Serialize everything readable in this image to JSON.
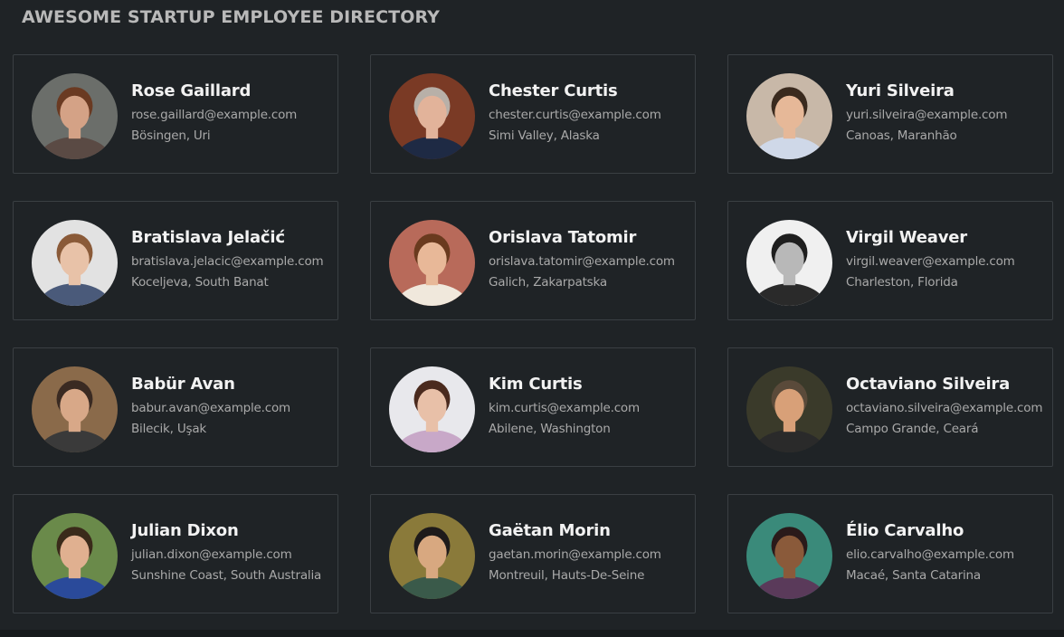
{
  "header": {
    "title": "AWESOME STARTUP EMPLOYEE DIRECTORY"
  },
  "employees": [
    {
      "name": "Rose Gaillard",
      "email": "rose.gaillard@example.com",
      "location": "Bösingen, Uri",
      "avatar": {
        "bg": "#6b6e6a",
        "skin": "#d4a286",
        "hair": "#6a3a22",
        "shirt": "#5a4a44"
      }
    },
    {
      "name": "Chester Curtis",
      "email": "chester.curtis@example.com",
      "location": "Simi Valley, Alaska",
      "avatar": {
        "bg": "#7a3a25",
        "skin": "#e2b39a",
        "hair": "#b8b0a8",
        "shirt": "#1e2a44"
      }
    },
    {
      "name": "Yuri Silveira",
      "email": "yuri.silveira@example.com",
      "location": "Canoas, Maranhão",
      "avatar": {
        "bg": "#c8b8a8",
        "skin": "#e6b898",
        "hair": "#3a2a1e",
        "shirt": "#cfd8e8"
      }
    },
    {
      "name": "Bratislava Jelačić",
      "email": "bratislava.jelacic@example.com",
      "location": "Koceljeva, South Banat",
      "avatar": {
        "bg": "#e2e2e2",
        "skin": "#e8c2a8",
        "hair": "#8a5a38",
        "shirt": "#4a5a7a"
      }
    },
    {
      "name": "Orislava Tatomir",
      "email": "orislava.tatomir@example.com",
      "location": "Galich, Zakarpatska",
      "avatar": {
        "bg": "#b86a5a",
        "skin": "#e8b898",
        "hair": "#6a3a1e",
        "shirt": "#f0e8dc"
      }
    },
    {
      "name": "Virgil Weaver",
      "email": "virgil.weaver@example.com",
      "location": "Charleston, Florida",
      "avatar": {
        "bg": "#f0f0f0",
        "skin": "#b8b8b8",
        "hair": "#1e1e1e",
        "shirt": "#2a2a2a"
      }
    },
    {
      "name": "Babür Avan",
      "email": "babur.avan@example.com",
      "location": "Bilecik, Uşak",
      "avatar": {
        "bg": "#8a6a4a",
        "skin": "#d8a888",
        "hair": "#3a2a22",
        "shirt": "#3a3a3a"
      }
    },
    {
      "name": "Kim Curtis",
      "email": "kim.curtis@example.com",
      "location": "Abilene, Washington",
      "avatar": {
        "bg": "#e8e8ec",
        "skin": "#e8c0a8",
        "hair": "#4a2a1e",
        "shirt": "#c8a8c8"
      }
    },
    {
      "name": "Octaviano Silveira",
      "email": "octaviano.silveira@example.com",
      "location": "Campo Grande, Ceará",
      "avatar": {
        "bg": "#3a3a2a",
        "skin": "#d8a078",
        "hair": "#5a4a3a",
        "shirt": "#2a2a2a"
      }
    },
    {
      "name": "Julian Dixon",
      "email": "julian.dixon@example.com",
      "location": "Sunshine Coast, South Australia",
      "avatar": {
        "bg": "#6a8a4a",
        "skin": "#e0b090",
        "hair": "#3a2a1a",
        "shirt": "#2a4a9a"
      }
    },
    {
      "name": "Gaëtan Morin",
      "email": "gaetan.morin@example.com",
      "location": "Montreuil, Hauts-De-Seine",
      "avatar": {
        "bg": "#8a7a3a",
        "skin": "#d8a880",
        "hair": "#1e1a1a",
        "shirt": "#3a5a4a"
      }
    },
    {
      "name": "Élio Carvalho",
      "email": "elio.carvalho@example.com",
      "location": "Macaé, Santa Catarina",
      "avatar": {
        "bg": "#3a8a7a",
        "skin": "#8a5a3a",
        "hair": "#2a1a1a",
        "shirt": "#5a3a5a"
      }
    }
  ]
}
